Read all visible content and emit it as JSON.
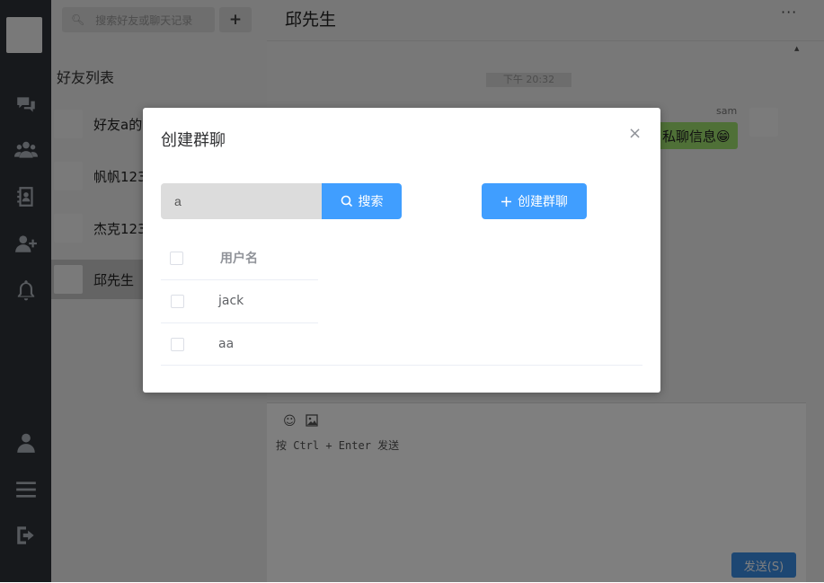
{
  "friends_panel": {
    "search_placeholder": "搜索好友或聊天记录",
    "add_label": "+",
    "title": "好友列表",
    "items": [
      {
        "name": "好友a的"
      },
      {
        "name": "帆帆123"
      },
      {
        "name": "杰克123"
      },
      {
        "name": "邱先生",
        "selected": true
      }
    ]
  },
  "chat": {
    "title": "邱先生",
    "more": "···",
    "time": "下午 20:32",
    "message": {
      "sender": "sam",
      "text": "私聊信息😁"
    },
    "composer_placeholder": "按 Ctrl + Enter 发送",
    "send_label": "发送(S)"
  },
  "modal": {
    "title": "创建群聊",
    "close": "×",
    "search_value": "a",
    "search_button": "搜索",
    "create_button": "创建群聊",
    "table": {
      "header": "用户名",
      "rows": [
        "jack",
        "aa"
      ]
    }
  },
  "colors": {
    "nav_bg": "#2e3238",
    "primary": "#409eff",
    "bubble": "#9fe06e",
    "send": "#3a8ee6"
  }
}
